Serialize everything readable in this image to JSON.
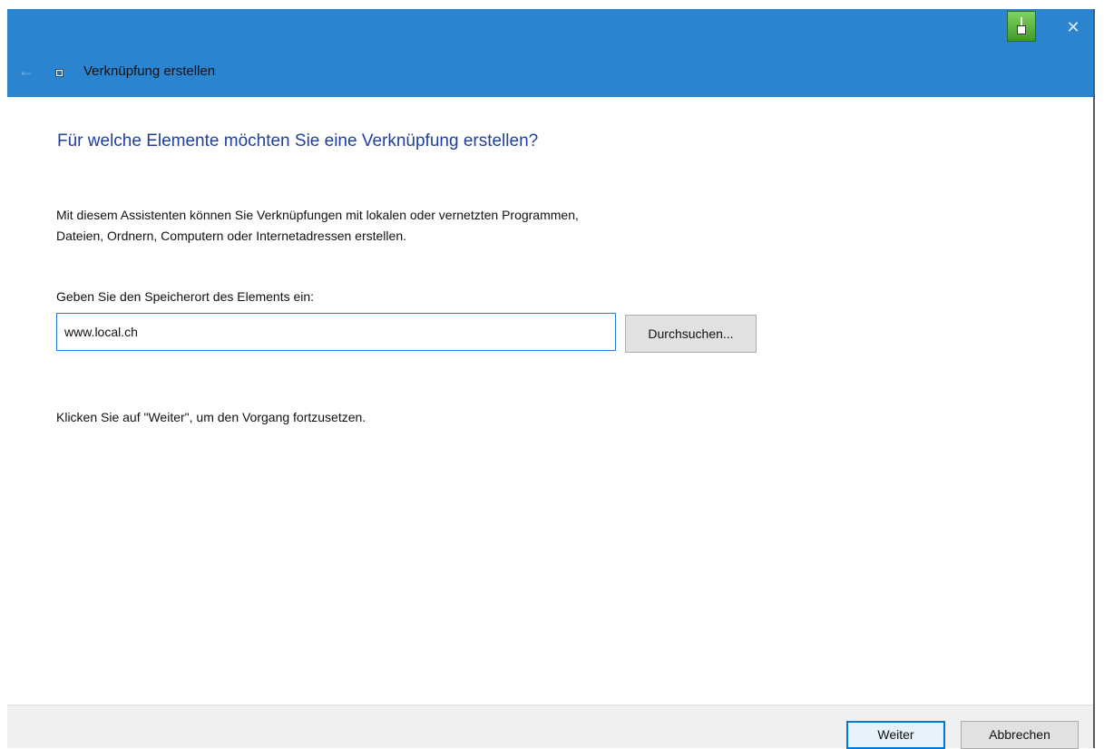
{
  "window": {
    "title": "Verknüpfung erstellen",
    "icons": {
      "back": "back-arrow-icon",
      "shortcut": "shortcut-icon",
      "app": "green-app-icon",
      "close": "close-icon"
    },
    "close_glyph": "✕",
    "back_glyph": "←"
  },
  "wizard": {
    "heading": "Für welche Elemente möchten Sie eine Verknüpfung erstellen?",
    "description_line1": "Mit diesem Assistenten können Sie Verknüpfungen mit lokalen oder vernetzten Programmen,",
    "description_line2": "Dateien, Ordnern, Computern oder Internetadressen erstellen.",
    "location_label": "Geben Sie den Speicherort des Elements ein:",
    "location_value": "www.local.ch",
    "browse_label": "Durchsuchen...",
    "hint": "Klicken Sie auf \"Weiter\", um den Vorgang fortzusetzen."
  },
  "footer": {
    "next_label": "Weiter",
    "cancel_label": "Abbrechen"
  },
  "colors": {
    "titlebar": "#2b84d0",
    "heading": "#1f3f9f",
    "input_border": "#2b7cd8",
    "primary_button_border": "#0078d7"
  }
}
